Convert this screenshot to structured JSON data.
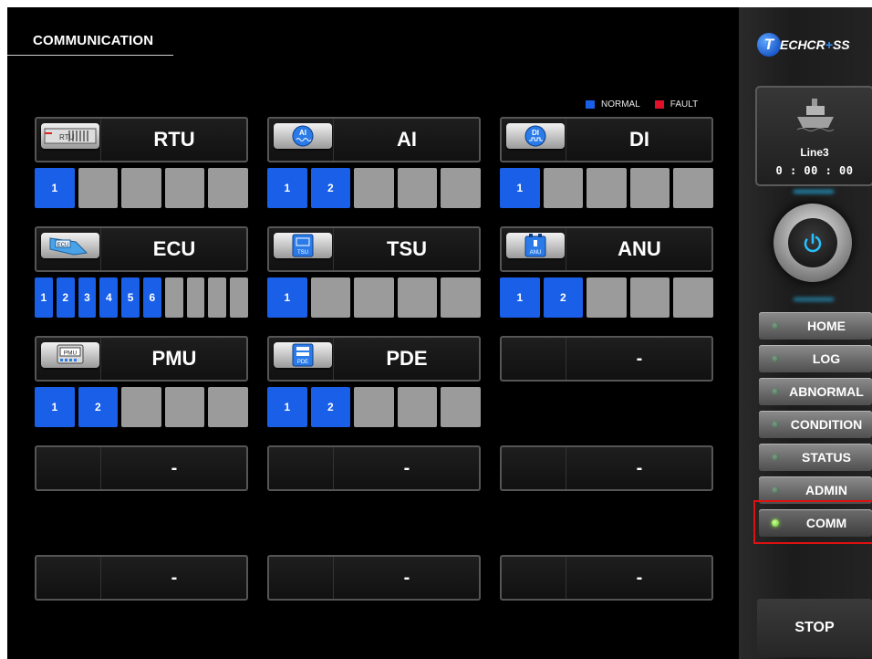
{
  "page_title": "COMMUNICATION",
  "legend": [
    {
      "label": "NORMAL",
      "color": "#1a5fe8"
    },
    {
      "label": "FAULT",
      "color": "#e0102a"
    }
  ],
  "modules": [
    {
      "name": "RTU",
      "icon": "rtu-icon",
      "icon_text": "RTU",
      "channels": [
        {
          "label": "1",
          "status": "normal"
        },
        {
          "label": "",
          "status": "off"
        },
        {
          "label": "",
          "status": "off"
        },
        {
          "label": "",
          "status": "off"
        },
        {
          "label": "",
          "status": "off"
        }
      ]
    },
    {
      "name": "AI",
      "icon": "ai-icon",
      "icon_text": "AI",
      "channels": [
        {
          "label": "1",
          "status": "normal"
        },
        {
          "label": "2",
          "status": "normal"
        },
        {
          "label": "",
          "status": "off"
        },
        {
          "label": "",
          "status": "off"
        },
        {
          "label": "",
          "status": "off"
        }
      ]
    },
    {
      "name": "DI",
      "icon": "di-icon",
      "icon_text": "DI",
      "channels": [
        {
          "label": "1",
          "status": "normal"
        },
        {
          "label": "",
          "status": "off"
        },
        {
          "label": "",
          "status": "off"
        },
        {
          "label": "",
          "status": "off"
        },
        {
          "label": "",
          "status": "off"
        }
      ]
    },
    {
      "name": "ECU",
      "icon": "ecu-icon",
      "icon_text": "ECU",
      "channels": [
        {
          "label": "1",
          "status": "normal"
        },
        {
          "label": "2",
          "status": "normal"
        },
        {
          "label": "3",
          "status": "normal"
        },
        {
          "label": "4",
          "status": "normal"
        },
        {
          "label": "5",
          "status": "normal"
        },
        {
          "label": "6",
          "status": "normal"
        },
        {
          "label": "",
          "status": "off"
        },
        {
          "label": "",
          "status": "off"
        },
        {
          "label": "",
          "status": "off"
        },
        {
          "label": "",
          "status": "off"
        }
      ]
    },
    {
      "name": "TSU",
      "icon": "tsu-icon",
      "icon_text": "TSU",
      "channels": [
        {
          "label": "1",
          "status": "normal"
        },
        {
          "label": "",
          "status": "off"
        },
        {
          "label": "",
          "status": "off"
        },
        {
          "label": "",
          "status": "off"
        },
        {
          "label": "",
          "status": "off"
        }
      ]
    },
    {
      "name": "ANU",
      "icon": "anu-icon",
      "icon_text": "ANU",
      "channels": [
        {
          "label": "1",
          "status": "normal"
        },
        {
          "label": "2",
          "status": "normal"
        },
        {
          "label": "",
          "status": "off"
        },
        {
          "label": "",
          "status": "off"
        },
        {
          "label": "",
          "status": "off"
        }
      ]
    },
    {
      "name": "PMU",
      "icon": "pmu-icon",
      "icon_text": "PMU",
      "channels": [
        {
          "label": "1",
          "status": "normal"
        },
        {
          "label": "2",
          "status": "normal"
        },
        {
          "label": "",
          "status": "off"
        },
        {
          "label": "",
          "status": "off"
        },
        {
          "label": "",
          "status": "off"
        }
      ]
    },
    {
      "name": "PDE",
      "icon": "pde-icon",
      "icon_text": "PDE",
      "channels": [
        {
          "label": "1",
          "status": "normal"
        },
        {
          "label": "2",
          "status": "normal"
        },
        {
          "label": "",
          "status": "off"
        },
        {
          "label": "",
          "status": "off"
        },
        {
          "label": "",
          "status": "off"
        }
      ]
    }
  ],
  "empty_slot_label": "-",
  "sidebar": {
    "logo_mark": "T",
    "logo_text_a": "ECHCR",
    "logo_text_plus": "+",
    "logo_text_b": "SS",
    "line_name": "Line3",
    "line_time": "0 : 00 : 00",
    "nav": [
      {
        "label": "HOME",
        "active": false
      },
      {
        "label": "LOG",
        "active": false
      },
      {
        "label": "ABNORMAL",
        "active": false
      },
      {
        "label": "CONDITION",
        "active": false
      },
      {
        "label": "STATUS",
        "active": false
      },
      {
        "label": "ADMIN",
        "active": false
      },
      {
        "label": "COMM",
        "active": true
      }
    ],
    "stop_label": "STOP"
  }
}
